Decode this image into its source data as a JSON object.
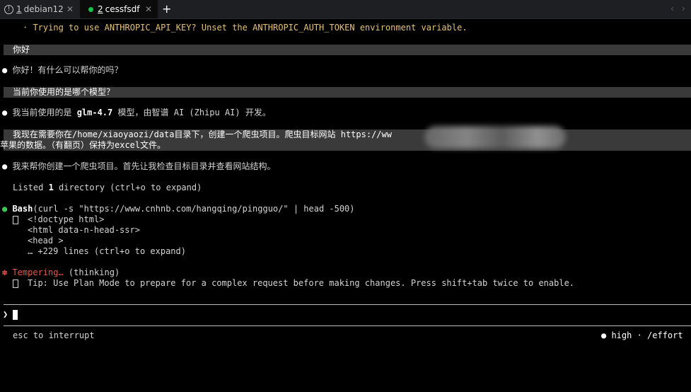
{
  "tabs": [
    {
      "num": "1",
      "label": "debian12",
      "close": "✕"
    },
    {
      "num": "2",
      "label": "cessfsdf",
      "close": "✕"
    }
  ],
  "new_tab": "+",
  "nav": {
    "prev": "‹",
    "next": "›"
  },
  "terminal": {
    "warning": "· Trying to use ANTHROPIC_API_KEY? Unset the ANTHROPIC_AUTH_TOKEN environment variable.",
    "user_msg_1": "你好",
    "reply_1": "你好！有什么可以帮你的吗？",
    "user_msg_2": "当前你使用的是哪个模型？",
    "reply_2_pre": "我当前使用的是 ",
    "reply_2_model": "glm-4.7",
    "reply_2_post": " 模型，由智谱 AI (Zhipu AI) 开发。",
    "user_msg_3_line1": "我现在需要你在/home/xiaoyaozi/data目录下，创建一个爬虫项目。爬虫目标网站 https://ww",
    "user_msg_3_line2": "苹果的数据。（有翻页）保持为excel文件。",
    "reply_3": "我来帮你创建一个爬虫项目。首先让我检查目标目录并查看网站结构。",
    "listed_pre": "Listed ",
    "listed_count": "1",
    "listed_post": " directory (ctrl+o to expand)",
    "bash_tool": "Bash",
    "bash_cmd": "(curl -s \"https://www.cnhnb.com/hangqing/pingguo/\" | head -500)",
    "out_1": "<!doctype html>",
    "out_2": "<html data-n-head-ssr>",
    "out_3": "<head >",
    "out_4": "… +229 lines (ctrl+o to expand)",
    "status_word": "Tempering…",
    "status_paren": " (thinking)",
    "tip": "Tip: Use Plan Mode to prepare for a complex request before making changes. Press shift+tab twice to enable.",
    "prompt": "❯",
    "footer_left": "esc to interrupt",
    "footer_right": "● high · /effort"
  },
  "colors": {
    "accent_green": "#3ec45a",
    "status_red": "#e05a4f",
    "warning_yellow": "#e5c07b"
  }
}
